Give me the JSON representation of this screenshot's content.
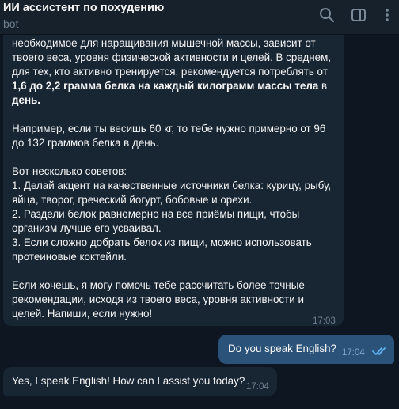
{
  "header": {
    "title": "ИИ ассистент по похудению",
    "subtitle": "bot",
    "icons": [
      "search-icon",
      "sidebar-toggle-icon",
      "more-vertical-icon"
    ]
  },
  "messages": {
    "bot_long": {
      "p1_a": "необходимое для наращивания мышечной массы, зависит от",
      "p1_b": "твоего веса, уровня физической активности и целей. В среднем,",
      "p1_c": "для тех, кто активно тренируется, рекомендуется потреблять от",
      "p1_bold_a": "1,6 до 2,2 грамма белка на каждый килограмм массы тела",
      "p1_d": " в",
      "p1_bold_b": "день.",
      "p2_a": "Например, если ты весишь 60 кг, то тебе нужно примерно от 96",
      "p2_b": "до 132 граммов белка в день.",
      "p3_a": "Вот несколько советов:",
      "p3_b": "1. Делай акцент на качественные источники белка: курицу, рыбу,",
      "p3_c": "яйца, творог, греческий йогурт, бобовые и орехи.",
      "p3_d": "2. Раздели белок равномерно на все приёмы пищи, чтобы",
      "p3_e": "организм лучше его усваивал.",
      "p3_f": "3. Если сложно добрать белок из пищи, можно использовать",
      "p3_g": "протеиновые коктейли.",
      "p4_a": "Если хочешь, я могу помочь тебе рассчитать более точные",
      "p4_b": "рекомендации, исходя из твоего веса, уровня активности и",
      "p4_c": "целей. Напиши, если нужно!",
      "time": "17:03"
    },
    "user_msg": {
      "text": "Do you speak English?",
      "time": "17:04",
      "status": "read"
    },
    "bot_reply": {
      "text": "Yes, I speak English! How can I assist you today?",
      "time": "17:04"
    }
  },
  "colors": {
    "background": "#0e1621",
    "header": "#17212b",
    "incoming_bubble": "#182533",
    "outgoing_bubble": "#2b5278",
    "read_check": "#5fb3f0"
  }
}
